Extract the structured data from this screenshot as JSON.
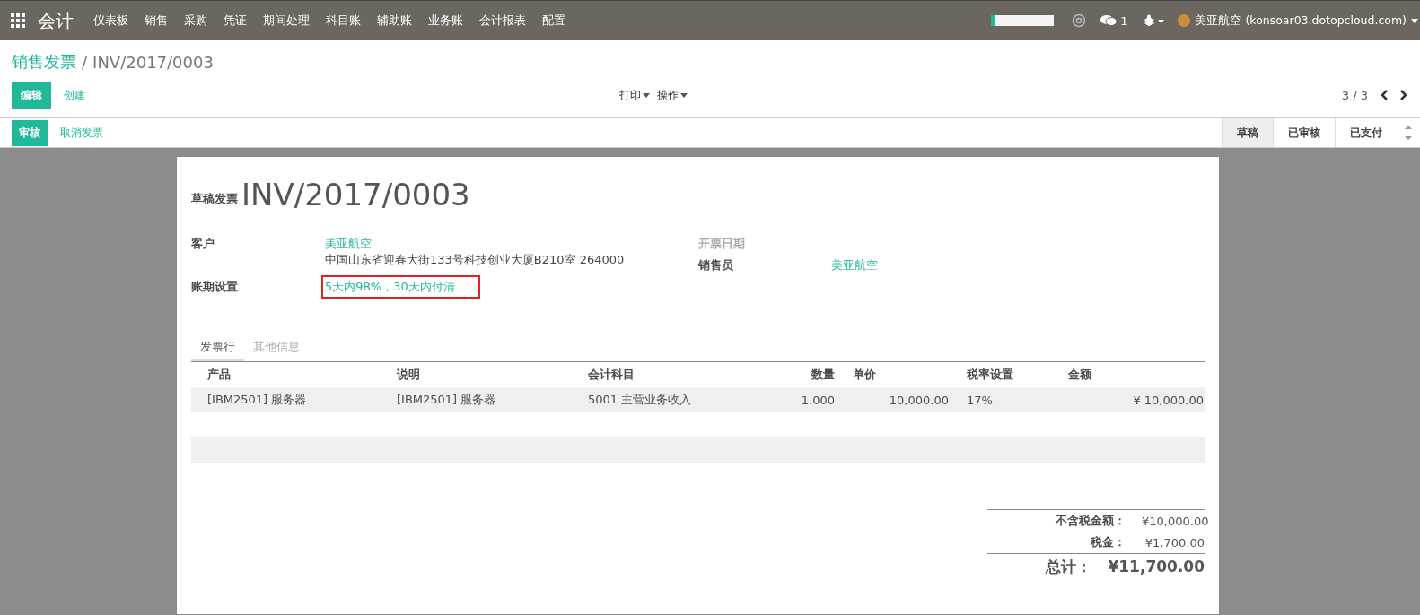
{
  "topbar": {
    "app_title": "会计",
    "menu": [
      "仪表板",
      "销售",
      "采购",
      "凭证",
      "期间处理",
      "科目账",
      "辅助账",
      "业务账",
      "会计报表",
      "配置"
    ],
    "chat_count": "1",
    "user": "美亚航空 (konsoar03.dotopcloud.com)"
  },
  "breadcrumb": {
    "parent": "销售发票",
    "separator": "/",
    "current": "INV/2017/0003"
  },
  "actions": {
    "edit": "编辑",
    "create": "创建",
    "print": "打印",
    "action": "操作",
    "pager": "3 / 3"
  },
  "workflow": {
    "buttons": [
      {
        "label": "审核",
        "kind": "primary"
      },
      {
        "label": "取消发票",
        "kind": "link"
      }
    ],
    "stages": [
      {
        "label": "草稿",
        "selected": true
      },
      {
        "label": "已审核",
        "selected": false
      },
      {
        "label": "已支付",
        "selected": false
      }
    ]
  },
  "sheet": {
    "status_label": "草稿发票",
    "number": "INV/2017/0003",
    "left_fields": [
      {
        "label": "客户",
        "value": "美亚航空",
        "kind": "link",
        "address": "中国山东省迎春大街133号科技创业大厦B210室 264000",
        "highlighted": false
      },
      {
        "label": "账期设置",
        "value": "5天内98%，30天内付清",
        "kind": "link",
        "highlighted": true
      }
    ],
    "right_fields": [
      {
        "label": "开票日期",
        "muted": true
      },
      {
        "label": "销售员",
        "value": "美亚航空",
        "kind": "link",
        "muted": false
      }
    ],
    "tabs": [
      {
        "label": "发票行",
        "selected": true
      },
      {
        "label": "其他信息",
        "selected": false
      }
    ],
    "table": {
      "columns": [
        "产品",
        "说明",
        "会计科目",
        "数量",
        "单价",
        "税率设置",
        "金额"
      ],
      "rows": [
        [
          "[IBM2501] 服务器",
          "[IBM2501] 服务器",
          "5001 主营业务收入",
          "1.000",
          "10,000.00",
          "17%",
          "¥ 10,000.00"
        ]
      ]
    },
    "totals": [
      {
        "label": "不含税金额：",
        "value": "¥10,000.00",
        "kind": "normal"
      },
      {
        "label": "税金：",
        "value": "¥1,700.00",
        "kind": "normal"
      },
      {
        "label": "总计：",
        "value": "¥11,700.00",
        "kind": "grand"
      }
    ]
  }
}
